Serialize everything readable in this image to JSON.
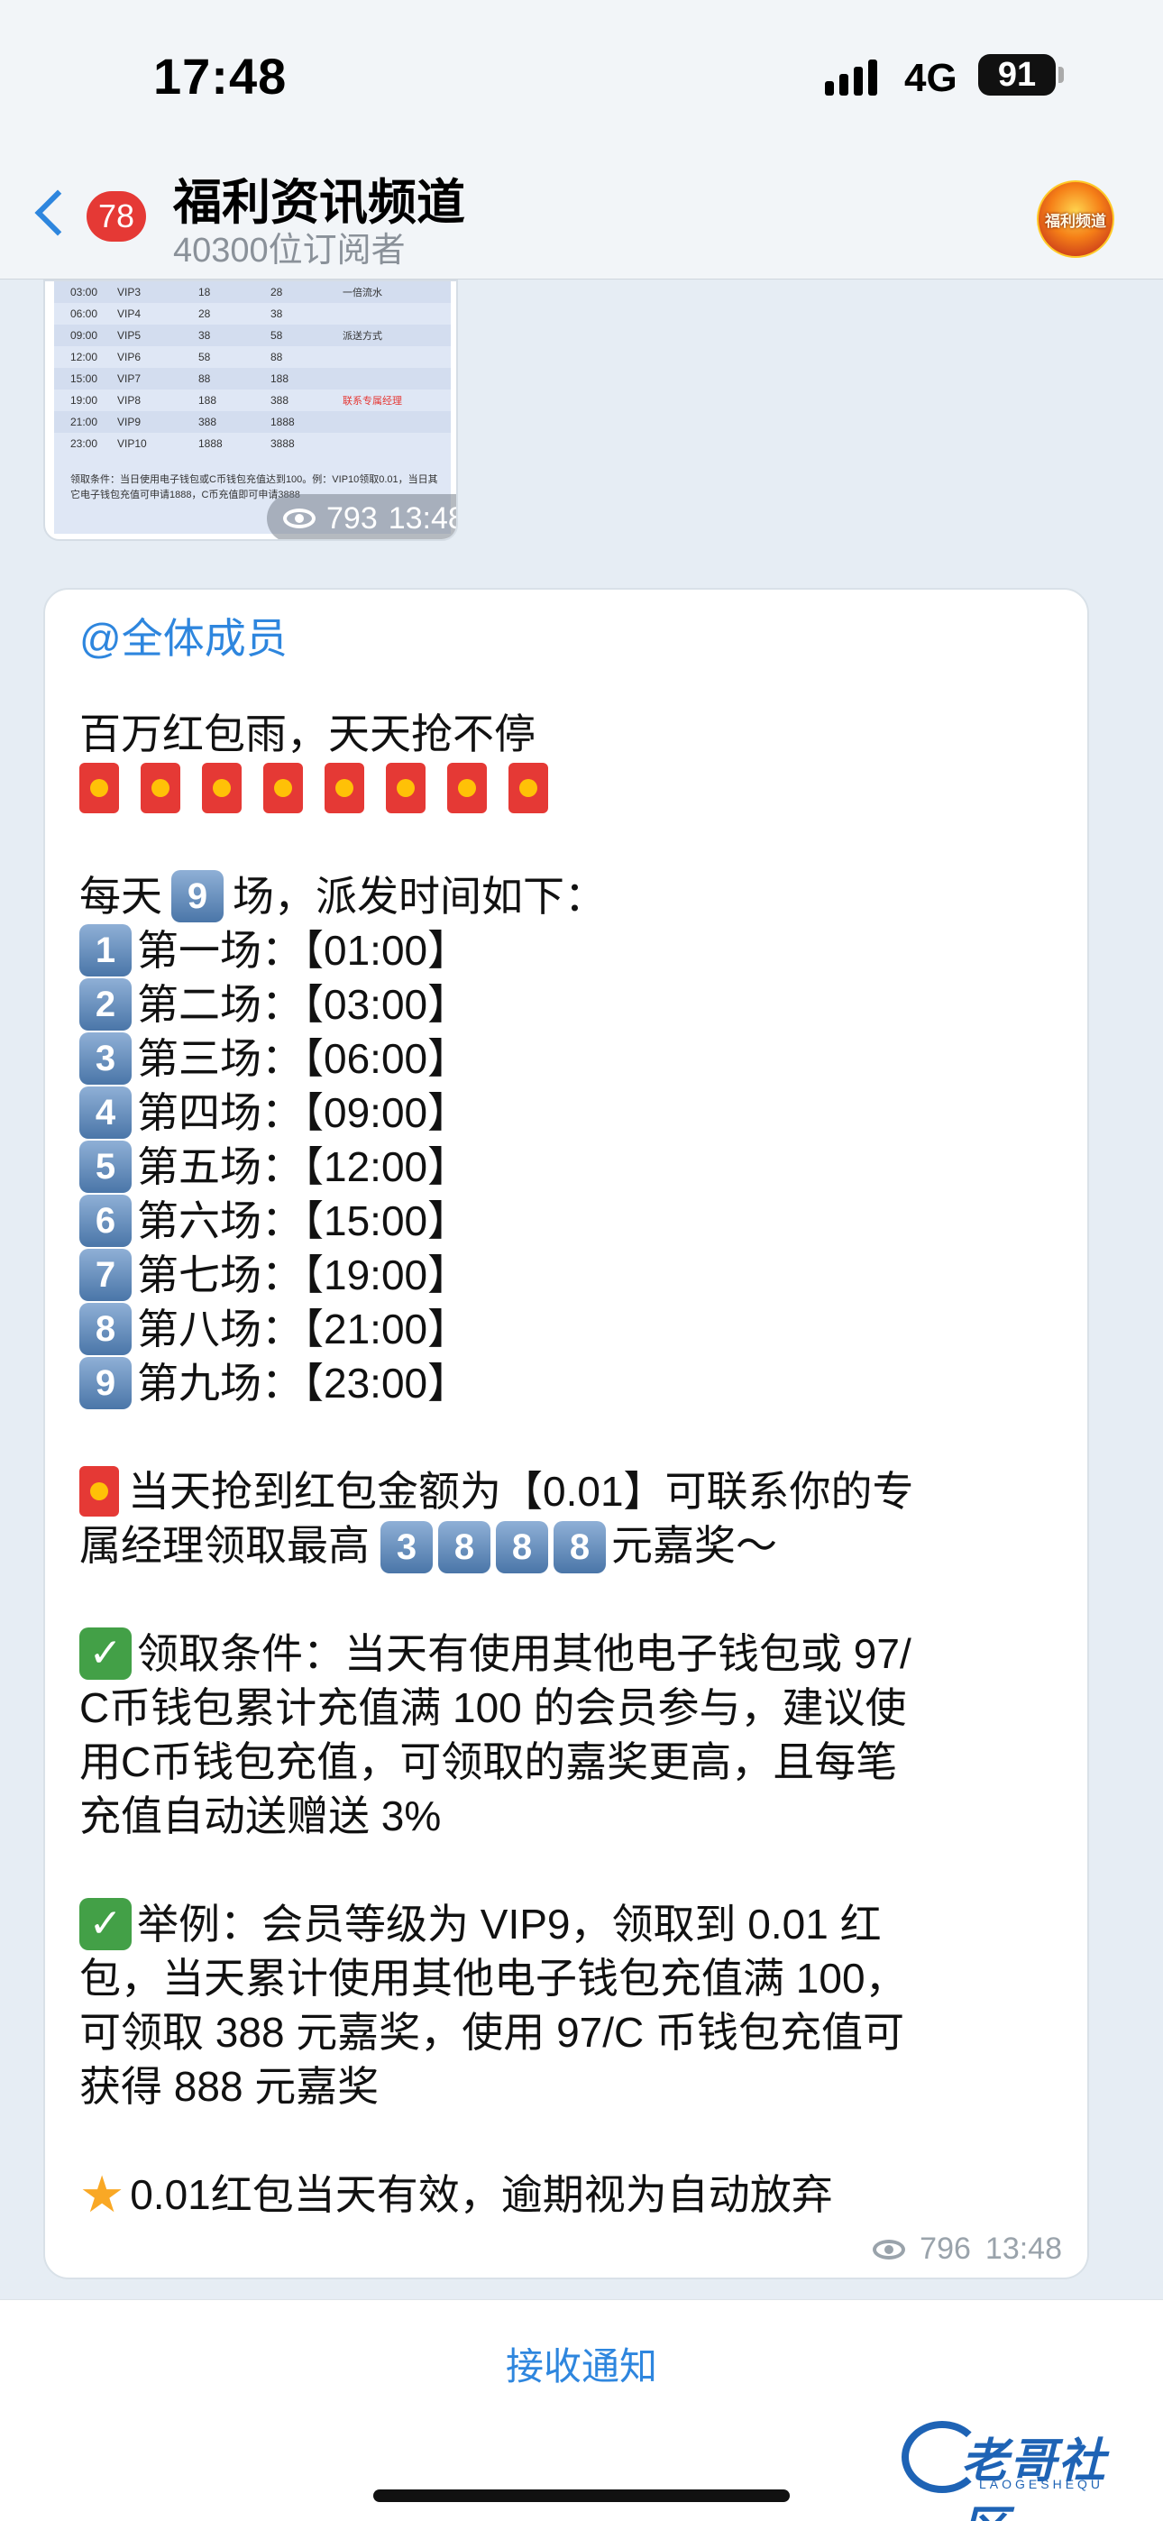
{
  "status_bar": {
    "time": "17:48",
    "network": "4G",
    "battery": "91"
  },
  "header": {
    "back_count": "78",
    "title": "福利资讯频道",
    "subtitle": "40300位订阅者",
    "avatar_text": "福利频道"
  },
  "image_message": {
    "rows": [
      [
        "03:00",
        "VIP3",
        "18",
        "28",
        "一倍流水"
      ],
      [
        "06:00",
        "VIP4",
        "28",
        "38",
        ""
      ],
      [
        "09:00",
        "VIP5",
        "38",
        "58",
        "派送方式"
      ],
      [
        "12:00",
        "VIP6",
        "58",
        "88",
        ""
      ],
      [
        "15:00",
        "VIP7",
        "88",
        "188",
        ""
      ],
      [
        "19:00",
        "VIP8",
        "188",
        "388",
        "联系专属经理"
      ],
      [
        "21:00",
        "VIP9",
        "388",
        "1888",
        ""
      ],
      [
        "23:00",
        "VIP10",
        "1888",
        "3888",
        ""
      ]
    ],
    "caption": "领取条件：当日使用电子钱包或C币钱包充值达到100。例：VIP10领取0.01，当日其它电子钱包充值可申请1888，C币充值即可申请3888",
    "views": "793",
    "time": "13:48"
  },
  "message": {
    "mention": "@全体成员",
    "headline": "百万红包雨，天天抢不停",
    "envelope_count": 8,
    "schedule_intro_pre": "每天",
    "schedule_intro_num": "9",
    "schedule_intro_post": "场，派发时间如下：",
    "schedule": [
      {
        "num": "1",
        "text": "第一场：【01:00】"
      },
      {
        "num": "2",
        "text": "第二场：【03:00】"
      },
      {
        "num": "3",
        "text": "第三场：【06:00】"
      },
      {
        "num": "4",
        "text": "第四场：【09:00】"
      },
      {
        "num": "5",
        "text": "第五场：【12:00】"
      },
      {
        "num": "6",
        "text": "第六场：【15:00】"
      },
      {
        "num": "7",
        "text": "第七场：【19:00】"
      },
      {
        "num": "8",
        "text": "第八场：【21:00】"
      },
      {
        "num": "9",
        "text": "第九场：【23:00】"
      }
    ],
    "prize_line1": "当天抢到红包金额为【0.01】可联系你的专",
    "prize_line2_pre": "属经理领取最高",
    "prize_digits": [
      "3",
      "8",
      "8",
      "8"
    ],
    "prize_line2_post": "元嘉奖～",
    "condition_lines": [
      "领取条件：当天有使用其他电子钱包或 97/",
      "C币钱包累计充值满 100 的会员参与，建议使",
      "用C币钱包充值，可领取的嘉奖更高，且每笔",
      "充值自动送赠送 3%"
    ],
    "example_lines": [
      "举例：会员等级为 VIP9，领取到 0.01 红",
      "包，当天累计使用其他电子钱包充值满 100，",
      "可领取 388 元嘉奖，使用 97/C 币钱包充值可",
      "获得 888 元嘉奖"
    ],
    "validity": "0.01红包当天有效，逾期视为自动放弃",
    "views": "796",
    "time": "13:48"
  },
  "bottom": {
    "notify_label": "接收通知",
    "watermark_text": "老哥社区",
    "watermark_sub": "LAOGESHEQU"
  },
  "colors": {
    "accent": "#2e86de",
    "badge": "#e53935",
    "check": "#43a047"
  }
}
